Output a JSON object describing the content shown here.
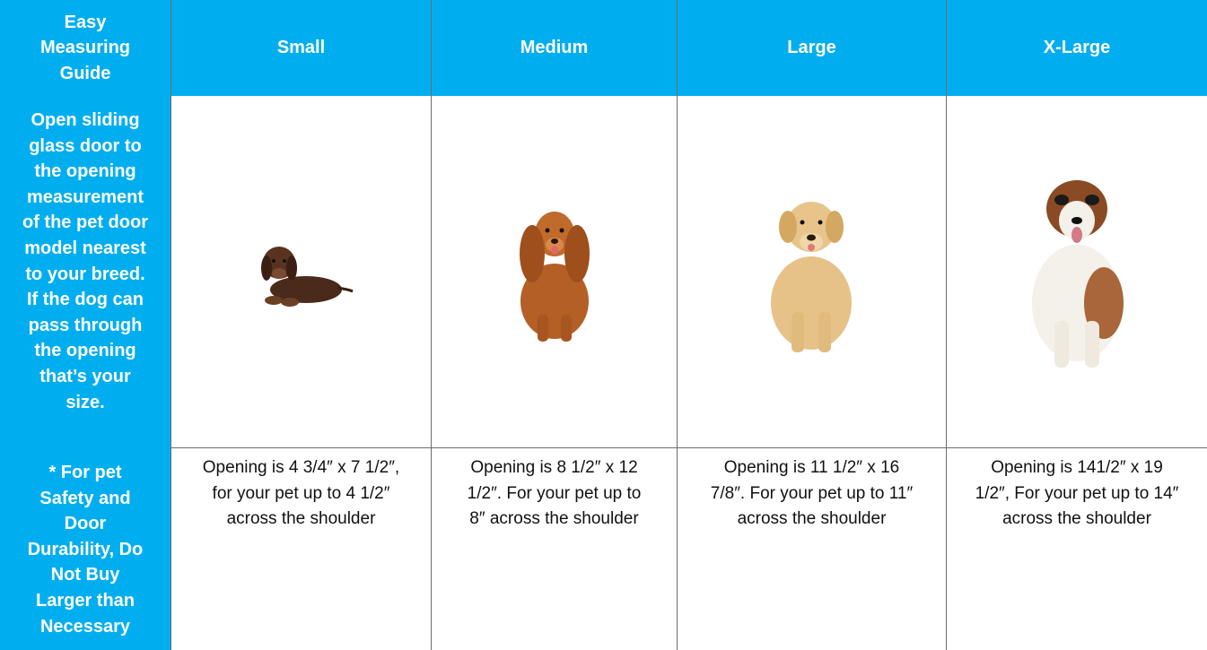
{
  "guide": {
    "title": "Easy Measuring Guide",
    "instructions": "Open sliding glass door to the opening measurement of the pet door model nearest to your breed. If the dog can pass through the opening that’s your size.",
    "warning": "* For pet Safety and Door Durability, Do Not Buy Larger than Necessary"
  },
  "columns": [
    {
      "size": "Small",
      "dog_icon": "dachshund-puppy-image",
      "description": "Opening is 4 3/4″ x 7 1/2″, for your pet up to 4 1/2″ across the shoulder"
    },
    {
      "size": "Medium",
      "dog_icon": "cocker-spaniel-image",
      "description": "Opening is 8 1/2″ x 12 1/2″. For your pet up to 8″ across the shoulder"
    },
    {
      "size": "Large",
      "dog_icon": "golden-retriever-image",
      "description": "Opening is 11 1/2″ x 16 7/8″. For your pet up to 11″ across the shoulder"
    },
    {
      "size": "X-Large",
      "dog_icon": "saint-bernard-image",
      "description": "Opening is 141/2″ x 19 1/2″, For your pet up to 14″ across the shoulder"
    }
  ],
  "colors": {
    "header_bg": "#00aeef",
    "header_text": "#ffffff",
    "border": "#6d6d6d"
  }
}
